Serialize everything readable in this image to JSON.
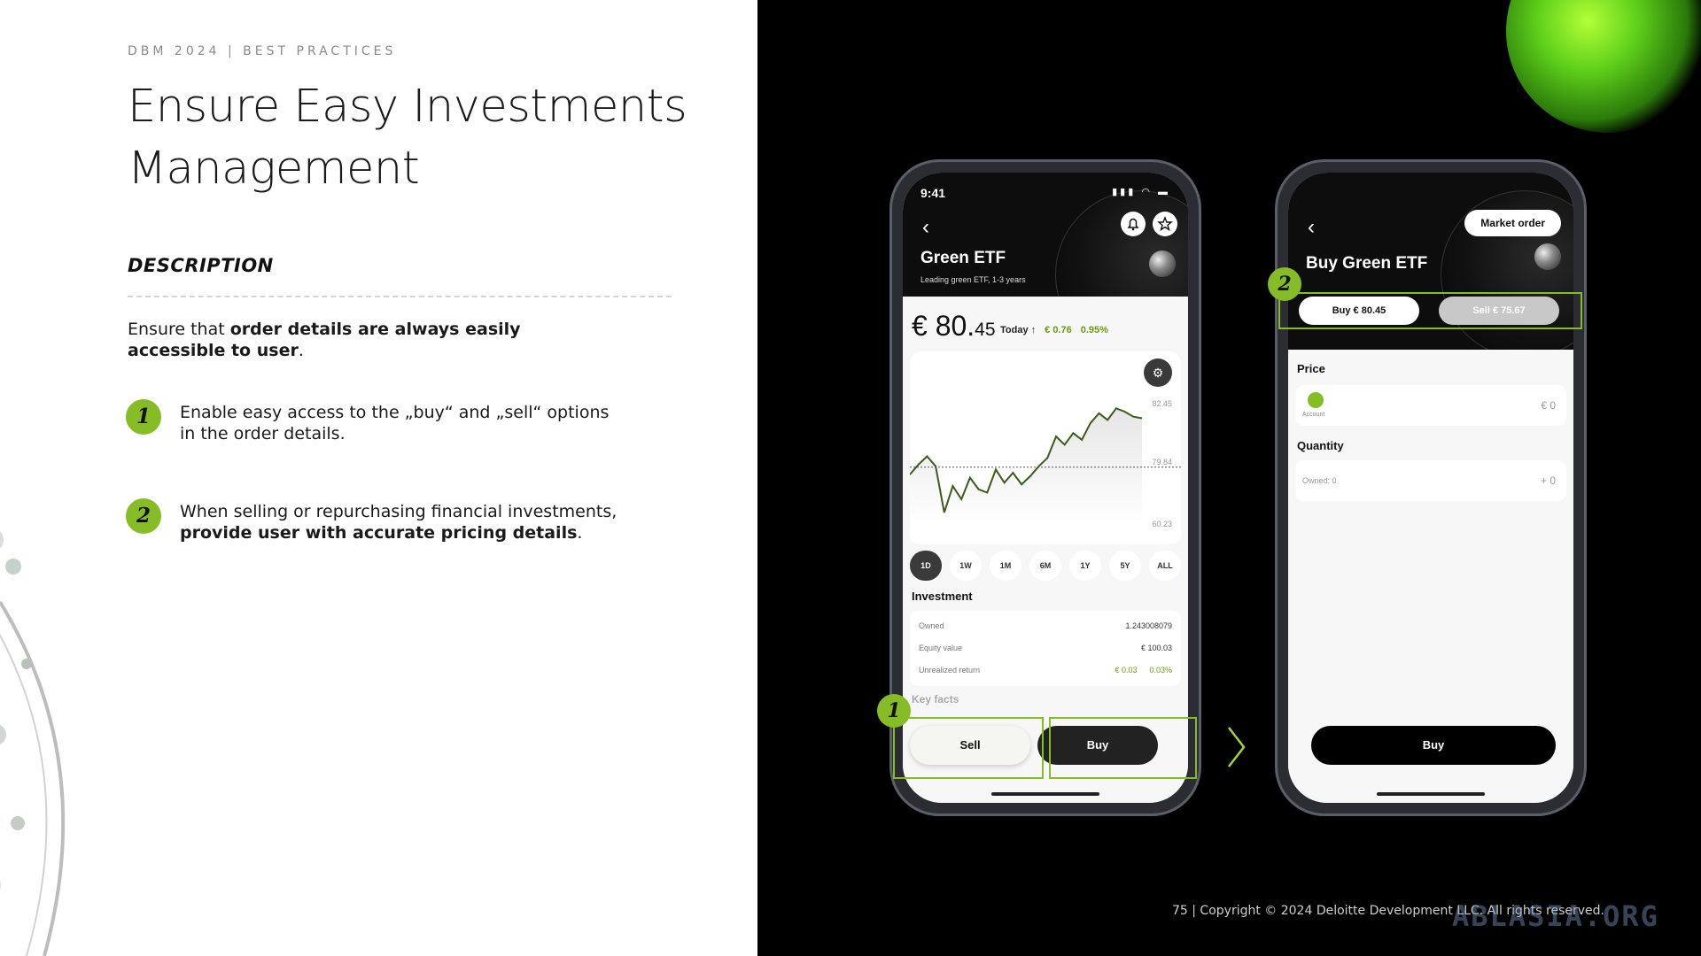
{
  "slide": {
    "kicker": "DBM 2024 | BEST PRACTICES",
    "title": "Ensure Easy Investments Management",
    "description_heading": "DESCRIPTION",
    "intro_prefix": "Ensure that ",
    "intro_bold": "order details are always easily accessible to user",
    "intro_suffix": ".",
    "points": [
      {
        "number": "1",
        "text": "Enable easy access to the „buy“ and „sell“ options in the order details.",
        "bold": "",
        "suffix": ""
      },
      {
        "number": "2",
        "text": "When selling or repurchasing financial investments, ",
        "bold": "provide user with accurate pricing details",
        "suffix": "."
      }
    ],
    "copyright": "75 | Copyright © 2024 Deloitte Development LLC. All rights reserved.",
    "watermark": "ABLASIA.ORG",
    "accent_color": "#86bc25"
  },
  "phone1": {
    "time": "9:41",
    "title": "Green ETF",
    "subtitle": "Leading green ETF,  1-3 years",
    "price_main": "€ 80.",
    "price_decimals": "45",
    "today_label": "Today ↑",
    "change_abs": "€ 0.76",
    "change_pct": "0.95%",
    "y_ticks": [
      "82.45",
      "79.84",
      "60.23"
    ],
    "ranges": [
      "1D",
      "1W",
      "1M",
      "6M",
      "1Y",
      "5Y",
      "ALL"
    ],
    "selected_range": "1D",
    "investment_label": "Investment",
    "investment": [
      {
        "label": "Owned",
        "value": "1.243008079",
        "extra": ""
      },
      {
        "label": "Equity value",
        "value": "€ 100.03",
        "extra": ""
      },
      {
        "label": "Unrealized return",
        "value": "€ 0.03",
        "extra": "0.03%"
      }
    ],
    "key_facts": "Key facts",
    "sell_label": "Sell",
    "buy_label": "Buy",
    "badge": "1"
  },
  "phone2": {
    "order_type": "Market order",
    "title": "Buy Green ETF",
    "tab_buy": "Buy € 80.45",
    "tab_sell": "Sell € 75.67",
    "price_label": "Price",
    "account_label": "Account",
    "price_value": "€ 0",
    "quantity_label": "Quantity",
    "owned_label": "Owned: 0",
    "quantity_value": "+ 0",
    "buy_label": "Buy",
    "badge": "2"
  },
  "chart_data": {
    "type": "line",
    "title": "",
    "y_ticks": [
      82.45,
      79.84,
      60.23
    ],
    "reference_line": 79.84,
    "series": [
      {
        "values": [
          78.5,
          79.1,
          79.6,
          79.0,
          76.2,
          77.8,
          77.0,
          78.3,
          77.6,
          77.4,
          78.8,
          78.0,
          78.6,
          77.9,
          78.4,
          79.0,
          79.5,
          80.8,
          80.3,
          81.0,
          80.6,
          81.6,
          82.2,
          81.8,
          82.5,
          82.3,
          82.0,
          81.9
        ]
      }
    ]
  }
}
